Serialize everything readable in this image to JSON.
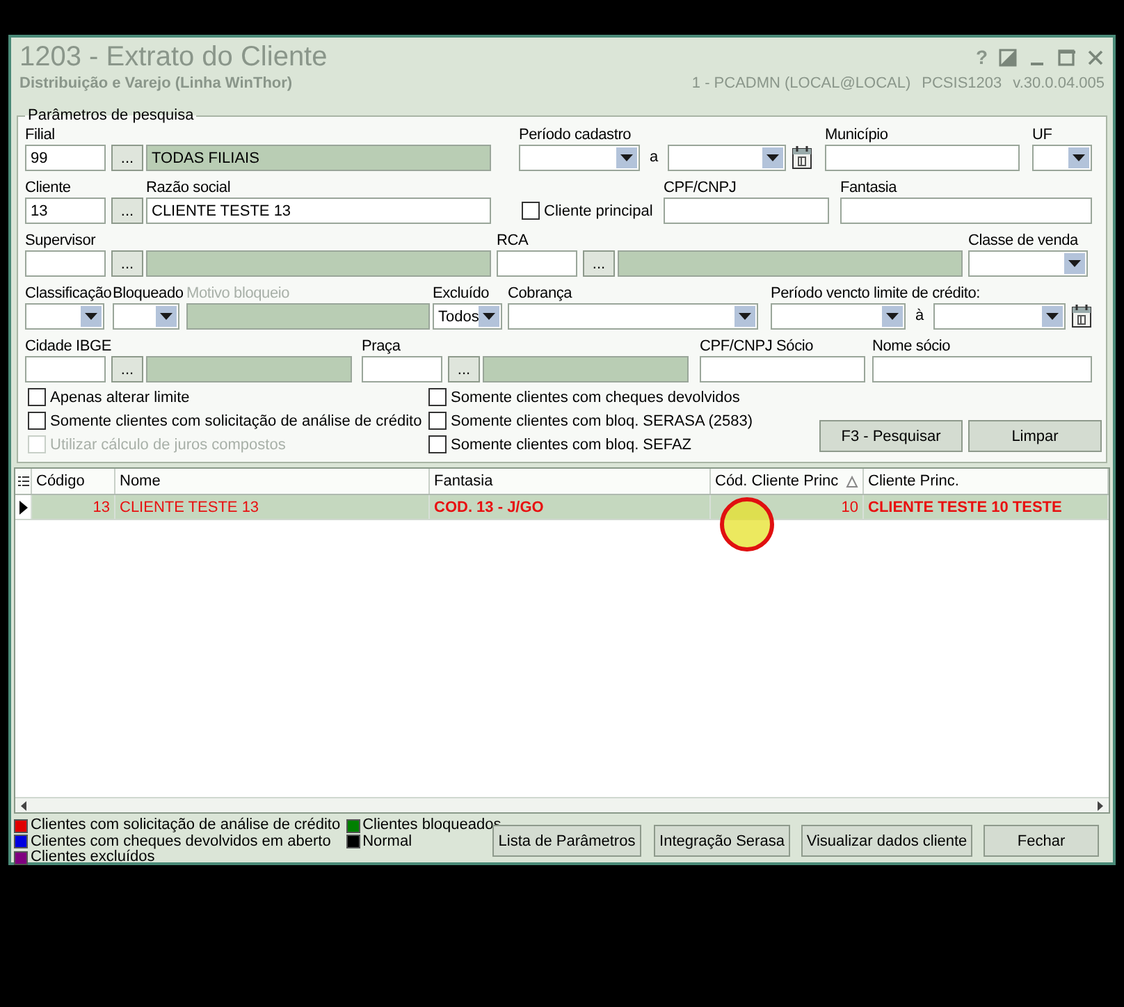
{
  "window": {
    "title": "1203 - Extrato do Cliente",
    "subtitle": "Distribuição e Varejo (Linha WinThor)",
    "help_button": "?",
    "user": "1 - PCADMN (LOCAL@LOCAL)",
    "program": "PCSIS1203",
    "version": "v.30.0.04.005"
  },
  "search_params": {
    "title": "Parâmetros de pesquisa",
    "fields": [
      {
        "kind": "lookup",
        "label": "Filial",
        "code": "99",
        "button": "...",
        "description": "TODAS FILIAIS",
        "description_editable": false
      },
      {
        "kind": "date_range",
        "label": "Período cadastro",
        "separator": "a"
      },
      {
        "kind": "text",
        "label": "Município",
        "disabled": false
      },
      {
        "kind": "combo",
        "label": "UF"
      },
      {
        "kind": "lookup",
        "label": "Cliente",
        "code": "13",
        "button": "...",
        "description_label": "Razão social",
        "description": "CLIENTE TESTE 13",
        "description_editable": true
      },
      {
        "kind": "check",
        "label": "Cliente principal",
        "checked": false
      },
      {
        "kind": "text",
        "label": "CPF/CNPJ",
        "disabled": false
      },
      {
        "kind": "text",
        "label": "Fantasia",
        "disabled": false
      },
      {
        "kind": "lookup",
        "label": "Supervisor",
        "button": "...",
        "description_editable": false
      },
      {
        "kind": "lookup",
        "label": "RCA",
        "button": "...",
        "description_editable": false
      },
      {
        "kind": "combo",
        "label": "Classe de venda"
      },
      {
        "kind": "combo",
        "label": "Classificação"
      },
      {
        "kind": "combo",
        "label": "Bloqueado"
      },
      {
        "kind": "text",
        "label": "Motivo bloqueio",
        "disabled": true
      },
      {
        "kind": "combo",
        "label": "Excluído",
        "value": "Todos"
      },
      {
        "kind": "combo",
        "label": "Cobrança"
      },
      {
        "kind": "date_range",
        "label": "Período vencto limite de crédito:",
        "separator": "à"
      },
      {
        "kind": "lookup",
        "label": "Cidade IBGE",
        "button": "...",
        "description_editable": false
      },
      {
        "kind": "lookup",
        "label": "Praça",
        "button": "...",
        "description_editable": false
      },
      {
        "kind": "text",
        "label": "CPF/CNPJ Sócio",
        "disabled": false
      },
      {
        "kind": "text",
        "label": "Nome sócio",
        "disabled": false
      }
    ],
    "options": [
      [
        {
          "label": "Apenas alterar limite",
          "checked": false,
          "disabled": false
        },
        {
          "label": "Somente clientes com solicitação de análise de crédito",
          "checked": false,
          "disabled": false
        },
        {
          "label": "Utilizar cálculo de juros compostos",
          "checked": false,
          "disabled": true
        }
      ],
      [
        {
          "label": "Somente clientes com cheques devolvidos",
          "checked": false,
          "disabled": false
        },
        {
          "label": "Somente clientes com bloq. SERASA (2583)",
          "checked": false,
          "disabled": false
        },
        {
          "label": "Somente clientes com bloq. SEFAZ",
          "checked": false,
          "disabled": false
        }
      ]
    ],
    "buttons": [
      "F3 - Pesquisar",
      "Limpar"
    ]
  },
  "grid": {
    "columns": [
      {
        "label": "Código",
        "sorted": false
      },
      {
        "label": "Nome",
        "sorted": false
      },
      {
        "label": "Fantasia",
        "sorted": false
      },
      {
        "label": "Cód. Cliente Princ",
        "sorted": true
      },
      {
        "label": "Cliente Princ.",
        "sorted": false
      }
    ],
    "rows": [
      {
        "selected": true,
        "color": "#e81010",
        "cells": [
          "13",
          "CLIENTE TESTE 13",
          "COD. 13 - J/GO",
          "10",
          "CLIENTE TESTE 10 TESTE"
        ]
      }
    ]
  },
  "legend": [
    {
      "label": "Clientes com solicitação de análise de crédito",
      "color": "#e00000"
    },
    {
      "label": "Clientes bloqueados",
      "color": "#008000"
    },
    {
      "label": "Clientes com cheques devolvidos em aberto",
      "color": "#0000e0"
    },
    {
      "label": "Normal",
      "color": "#000000"
    },
    {
      "label": "Clientes excluídos",
      "color": "#800080"
    }
  ],
  "footer_buttons": [
    "Lista de Parâmetros",
    "Integração Serasa",
    "Visualizar dados cliente",
    "Fechar"
  ]
}
